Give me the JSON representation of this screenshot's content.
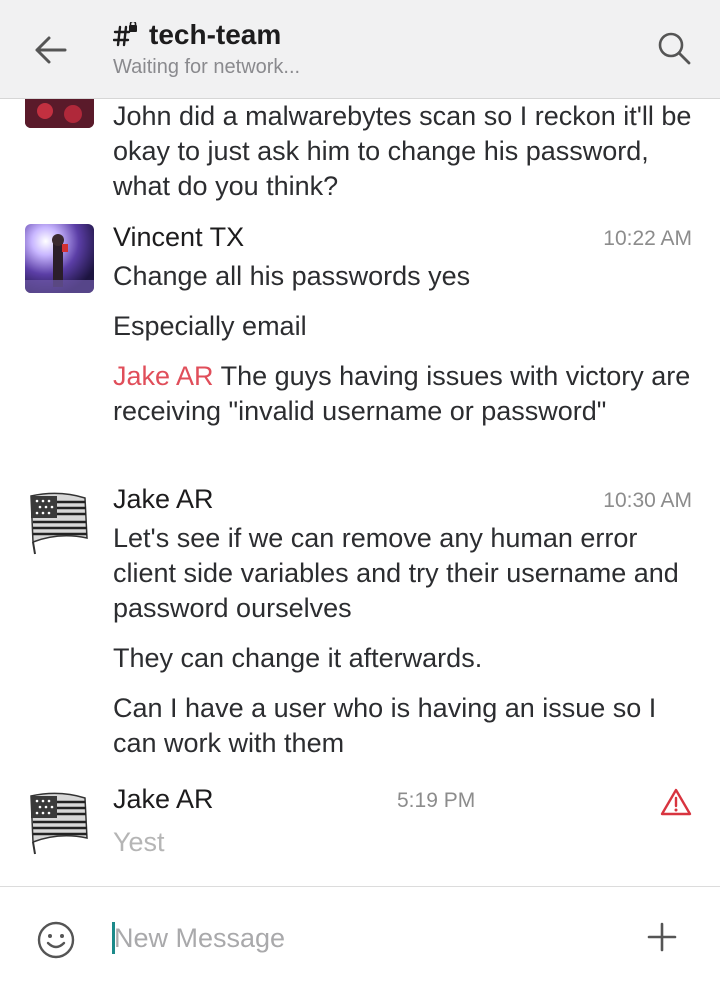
{
  "header": {
    "channel_name": "tech-team",
    "status": "Waiting for network..."
  },
  "messages": {
    "m0": {
      "lines": "John did a malwarebytes scan so I reckon it'll be okay to just ask him to change his password, what do you think?"
    },
    "m1": {
      "sender": "Vincent TX",
      "time": "10:22 AM",
      "line1": "Change all his passwords yes",
      "line2": "Especially email",
      "line3_mention": "Jake AR",
      "line3_text": " The guys having issues with victory are receiving \"invalid username or password\""
    },
    "m2": {
      "sender": "Jake AR",
      "time": "10:30 AM",
      "line1": "Let's see if we can remove any human error client side variables and try their username and password ourselves",
      "line2": "They can change it afterwards.",
      "line3": "Can I have a user who is having an issue so I can work with them"
    },
    "m3": {
      "sender": "Jake AR",
      "time": "5:19 PM",
      "text": "Yest",
      "status_icon": "warning-icon"
    }
  },
  "composer": {
    "placeholder": "New Message"
  },
  "colors": {
    "mention": "#e04e5a",
    "header_bg": "#f1f1f2",
    "cursor": "#1c8a8a"
  }
}
